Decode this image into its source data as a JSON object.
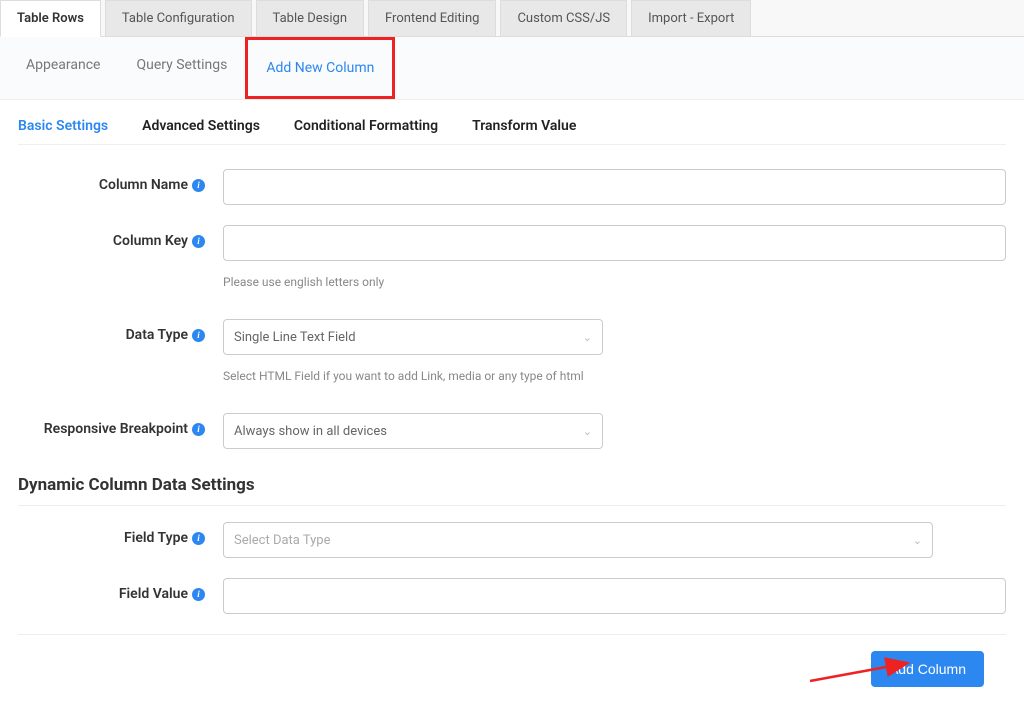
{
  "mainTabs": [
    "Table Rows",
    "Table Configuration",
    "Table Design",
    "Frontend Editing",
    "Custom CSS/JS",
    "Import - Export"
  ],
  "subTabs": {
    "appearance": "Appearance",
    "querySettings": "Query Settings",
    "addNewColumn": "Add New Column"
  },
  "settingTabs": {
    "basic": "Basic Settings",
    "advanced": "Advanced Settings",
    "conditional": "Conditional Formatting",
    "transform": "Transform Value"
  },
  "labels": {
    "columnName": "Column Name",
    "columnKey": "Column Key",
    "columnKeyHelp": "Please use english letters only",
    "dataType": "Data Type",
    "dataTypeHelp": "Select HTML Field if you want to add Link, media or any type of html",
    "responsiveBreakpoint": "Responsive Breakpoint",
    "fieldType": "Field Type",
    "fieldValue": "Field Value"
  },
  "sectionHeading": "Dynamic Column Data Settings",
  "values": {
    "dataType": "Single Line Text Field",
    "responsiveBreakpoint": "Always show in all devices",
    "fieldTypePlaceholder": "Select Data Type"
  },
  "buttons": {
    "addColumn": "Add Column"
  }
}
